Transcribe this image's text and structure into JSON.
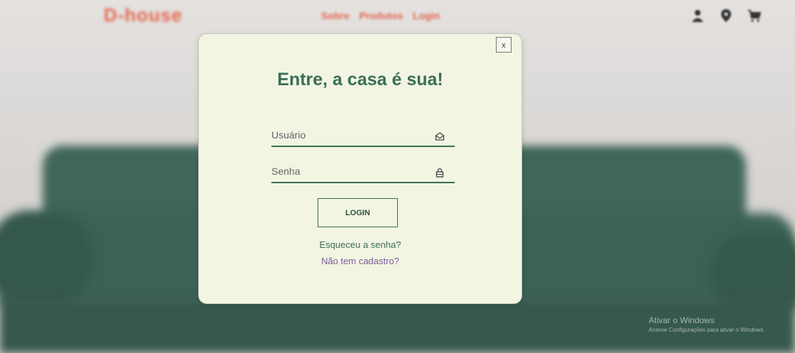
{
  "header": {
    "brand": "D-house",
    "nav": [
      "Sobre",
      "Produtos",
      "Login"
    ],
    "icons": [
      "user-icon",
      "location-pin-icon",
      "cart-icon"
    ]
  },
  "modal": {
    "close_label": "x",
    "title": "Entre, a casa é sua!",
    "username": {
      "placeholder": "Usuário",
      "value": "",
      "icon": "envelope-icon"
    },
    "password": {
      "placeholder": "Senha",
      "value": "",
      "icon": "lock-icon"
    },
    "login_label": "LOGIN",
    "forgot_label": "Esqueceu a senha?",
    "register_label": "Não tem cadastro?"
  },
  "watermark": {
    "line1": "Ativar o Windows",
    "line2": "Acesse Configurações para ativar o Windows."
  },
  "colors": {
    "accent": "#3a6e56",
    "modal_bg": "#f2f5e2",
    "brand": "#e4684f",
    "register_link": "#7d5a9a"
  }
}
